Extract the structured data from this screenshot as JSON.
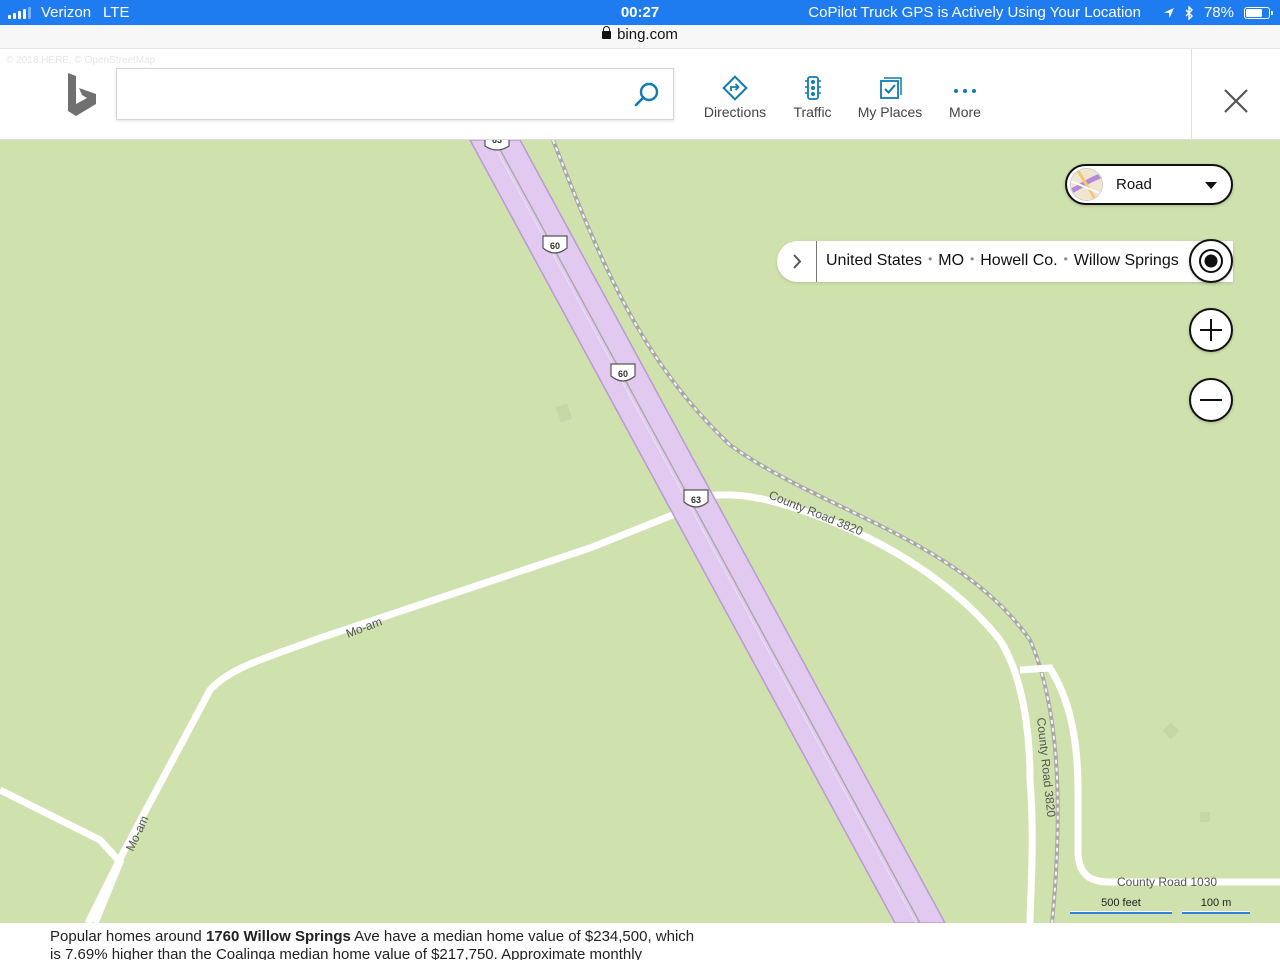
{
  "status_bar": {
    "carrier": "Verizon",
    "network": "LTE",
    "time": "00:27",
    "location_notice": "CoPilot Truck GPS is Actively Using Your Location",
    "battery": "78%",
    "battery_level": 0.78
  },
  "browser": {
    "url": "bing.com"
  },
  "header": {
    "copyright": "© 2018 HERE, © OpenStreetMap",
    "logo": "bing-logo",
    "search_value": "",
    "nav": [
      {
        "label": "Directions",
        "icon": "directions-icon"
      },
      {
        "label": "Traffic",
        "icon": "traffic-light-icon"
      },
      {
        "label": "My Places",
        "icon": "my-places-icon"
      },
      {
        "label": "More",
        "icon": "more-dots-icon"
      }
    ],
    "accent_color": "#0F7CB2"
  },
  "map": {
    "style_selector": "Road",
    "breadcrumb": [
      "United States",
      "MO",
      "Howell Co.",
      "Willow Springs"
    ],
    "roads": {
      "county_road_3820_a": "County Road 3820",
      "county_road_3820_b": "County Road 3820",
      "county_road_1030": "County Road 1030",
      "mo_am_a": "Mo-am",
      "mo_am_b": "Mo-am"
    },
    "shields": [
      "63",
      "60",
      "60",
      "63"
    ],
    "scale": {
      "feet": "500 feet",
      "meters": "100 m"
    },
    "colors": {
      "land": "#CFE2AE",
      "highway": "#E2C9F0",
      "road": "#FFFFFF",
      "rail": "#9A9A9A"
    }
  },
  "page": {
    "line1_prefix": "Popular homes around ",
    "line1_bold": "1760 Willow Springs",
    "line1_suffix": " Ave have a median home value of $234,500, which",
    "line2": "is 7.69% higher than the Coalinga median home value of $217,750. Approximate monthly"
  }
}
